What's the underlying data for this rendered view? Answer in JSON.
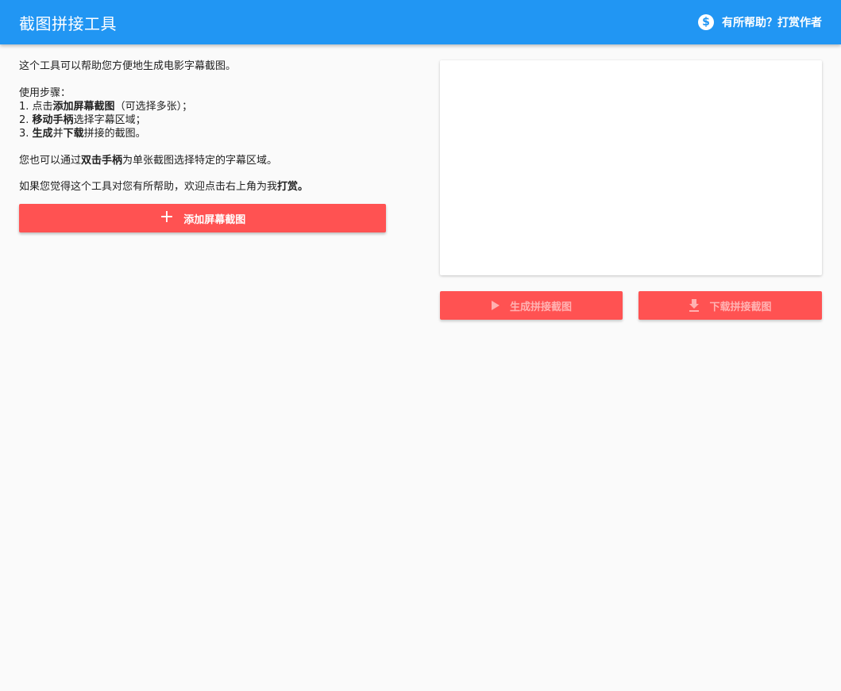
{
  "header": {
    "title": "截图拼接工具",
    "donate_label": "有所帮助？打赏作者",
    "donate_icon": "dollar-circle-icon",
    "bg_color": "#2196f3"
  },
  "intro": {
    "line1": "这个工具可以帮助您方便地生成电影字幕截图。",
    "steps_title": "使用步骤：",
    "step1_prefix": "1. 点击",
    "step1_bold": "添加屏幕截图",
    "step1_suffix": "（可选择多张）；",
    "step2_prefix": "2. ",
    "step2_bold": "移动手柄",
    "step2_suffix": "选择字幕区域；",
    "step3_prefix": "3. ",
    "step3_bold1": "生成",
    "step3_mid": "并",
    "step3_bold2": "下载",
    "step3_suffix": "拼接的截图。",
    "dbl_prefix": "您也可以通过",
    "dbl_bold": "双击手柄",
    "dbl_suffix": "为单张截图选择特定的字幕区域。",
    "reward_prefix": "如果您觉得这个工具对您有所帮助，欢迎点击右上角为我",
    "reward_bold": "打赏。"
  },
  "add_button": {
    "label": "添加屏幕截图",
    "icon": "plus-icon",
    "color": "#ff5252"
  },
  "actions": {
    "generate_label": "生成拼接截图",
    "generate_icon": "play-icon",
    "download_label": "下载拼接截图",
    "download_icon": "download-icon"
  }
}
